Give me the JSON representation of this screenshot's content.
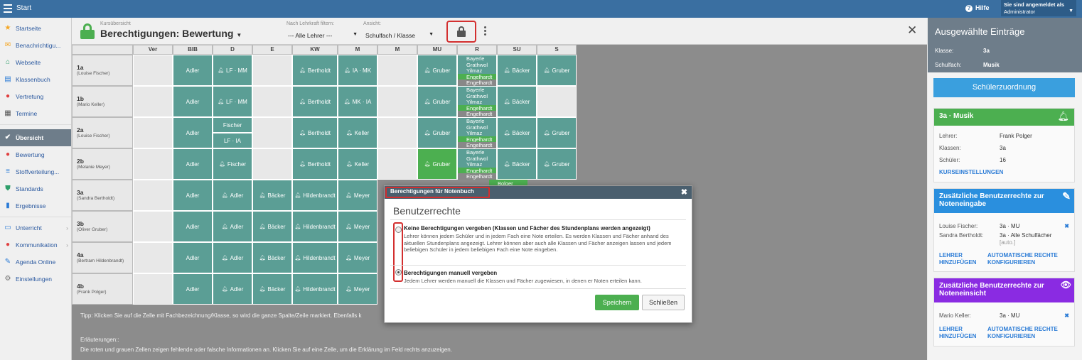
{
  "topbar": {
    "start": "Start",
    "help": "Hilfe",
    "logged_in": "Sie sind angemeldet als",
    "user": "Administrator"
  },
  "sidebar": {
    "items": [
      {
        "label": "Startseite",
        "icon": "star-icon",
        "color": "#f5a623"
      },
      {
        "label": "Benachrichtigu...",
        "icon": "envelope-icon",
        "color": "#f5a623"
      },
      {
        "label": "Webseite",
        "icon": "home-icon",
        "color": "#2e9e6a"
      },
      {
        "label": "Klassenbuch",
        "icon": "book-icon",
        "color": "#2a7bd6"
      },
      {
        "label": "Vertretung",
        "icon": "person-icon",
        "color": "#e04040"
      },
      {
        "label": "Termine",
        "icon": "calendar-icon",
        "color": "#555"
      },
      {
        "label": "Übersicht",
        "icon": "check-icon",
        "color": "#ffffff"
      },
      {
        "label": "Bewertung",
        "icon": "grade-icon",
        "color": "#e04040"
      },
      {
        "label": "Stoffverteilung...",
        "icon": "list-icon",
        "color": "#2a7bd6"
      },
      {
        "label": "Standards",
        "icon": "shield-icon",
        "color": "#2e9e6a"
      },
      {
        "label": "Ergebnisse",
        "icon": "chart-icon",
        "color": "#2a7bd6"
      },
      {
        "label": "Unterricht",
        "icon": "board-icon",
        "color": "#2a7bd6"
      },
      {
        "label": "Kommunikation",
        "icon": "chat-icon",
        "color": "#e04040"
      },
      {
        "label": "Agenda Online",
        "icon": "pen-icon",
        "color": "#2a7bd6"
      },
      {
        "label": "Einstellungen",
        "icon": "gear-icon",
        "color": "#777"
      }
    ]
  },
  "header": {
    "subtitle": "Kursübersicht",
    "title": "Berechtigungen: Bewertung",
    "filter_label": "Nach Lehrkraft filtern:",
    "filter_value": "--- Alle Lehrer ---",
    "view_label": "Ansicht:",
    "view_value": "Schulfach / Klasse"
  },
  "grid": {
    "columns": [
      "Ver",
      "BIB",
      "D",
      "E",
      "KW",
      "M",
      "M",
      "MU",
      "R",
      "SU",
      "S"
    ],
    "rows": [
      {
        "class": "1a",
        "teacher": "(Louise Fischer)",
        "cells": [
          "",
          "Adler",
          "LF · MM",
          "",
          "Bertholdt",
          "IA · MK",
          "",
          "Gruber",
          "R",
          "Bäcker",
          "Gruber"
        ]
      },
      {
        "class": "1b",
        "teacher": "(Mario Keller)",
        "cells": [
          "",
          "Adler",
          "LF · MM",
          "",
          "Bertholdt",
          "MK · IA",
          "",
          "Gruber",
          "R",
          "Bäcker",
          ""
        ]
      },
      {
        "class": "2a",
        "teacher": "(Louise Fischer)",
        "cells": [
          "",
          "Adler",
          "Fischer|LF · IA",
          "",
          "Bertholdt",
          "Keller",
          "",
          "Gruber",
          "R",
          "Bäcker",
          "Gruber"
        ]
      },
      {
        "class": "2b",
        "teacher": "(Melanie Meyer)",
        "cells": [
          "",
          "Adler",
          "Fischer",
          "",
          "Bertholdt",
          "Keller",
          "",
          "Gruber",
          "R",
          "Bäcker",
          "Gruber"
        ]
      },
      {
        "class": "3a",
        "teacher": "(Sandra Bertholdt)",
        "cells": [
          "",
          "Adler",
          "Adler",
          "Bäcker",
          "Hildenbrandt",
          "Meyer",
          "",
          "",
          "",
          "",
          ""
        ]
      },
      {
        "class": "3b",
        "teacher": "(Oliver Gruber)",
        "cells": [
          "",
          "Adler",
          "Adler",
          "Bäcker",
          "Hildenbrandt",
          "Meyer",
          "",
          "",
          "",
          "",
          ""
        ]
      },
      {
        "class": "4a",
        "teacher": "(Bertram Hildenbrandt)",
        "cells": [
          "",
          "Adler",
          "Adler",
          "Bäcker",
          "Hildenbrandt",
          "Meyer",
          "",
          "",
          "",
          "",
          ""
        ]
      },
      {
        "class": "4b",
        "teacher": "(Frank Polger)",
        "cells": [
          "",
          "Adler",
          "Adler",
          "Bäcker",
          "Hildenbrandt",
          "Meyer",
          "",
          "",
          "",
          "",
          ""
        ]
      }
    ],
    "r_names": [
      "Bayerle",
      "Grathwol",
      "Yilmaz",
      "Engelhardt",
      "Engelhardt"
    ],
    "r_partial": "Bolger"
  },
  "tip": "Tipp: Klicken Sie auf die Zelle mit Fachbezeichnung/Klasse, so wird die ganze Spalte/Zeile markiert. Ebenfalls k",
  "explain": {
    "title": "Erläuterungen::",
    "text": "Die roten und grauen Zellen zeigen fehlende oder falsche Informationen an. Klicken Sie auf eine Zelle, um die Erklärung im Feld rechts anzuzeigen."
  },
  "dialog": {
    "title": "Berechtigungen für Notenbuch",
    "heading": "Benutzerrechte",
    "opt1_title": "Keine Berechtigungen vergeben (Klassen und Fächer des Stundenplans werden angezeigt)",
    "opt1_text": "Lehrer können jedem Schüler und in jedem Fach eine Note erteilen. Es werden Klassen und Fächer anhand des aktuellen Stundenplans angezeigt. Lehrer können aber auch alle Klassen und Fächer anzeigen lassen und jedem beliebigen Schüler in jedem beliebigen Fach eine Note eingeben.",
    "opt2_title": "Berechtigungen manuell vergeben",
    "opt2_text": "Jedem Lehrer werden manuell die Klassen und Fächer zugewiesen, in denen er Noten erteilen kann.",
    "save": "Speichern",
    "close": "Schließen"
  },
  "right": {
    "title": "Ausgewählte Einträge",
    "klasse_label": "Klasse:",
    "klasse": "3a",
    "fach_label": "Schulfach:",
    "fach": "Musik",
    "assign_btn": "Schülerzuordnung",
    "card1": {
      "title": "3a · Musik",
      "color": "#4caf50",
      "lehrer_label": "Lehrer:",
      "lehrer": "Frank Polger",
      "klassen_label": "Klassen:",
      "klassen": "3a",
      "schueler_label": "Schüler:",
      "schueler": "16",
      "link": "KURSEINSTELLUNGEN"
    },
    "card2": {
      "title": "Zusätzliche Benutzerrechte zur Noteneingabe",
      "color": "#2a8fde",
      "r1_name": "Louise Fischer:",
      "r1_val": "3a · MU",
      "r2_name": "Sandra Bertholdt:",
      "r2_val": "3a · Alle Schulfächer",
      "r2_note": "[auto.]",
      "link1": "LEHRER HINZUFÜGEN",
      "link2": "AUTOMATISCHE RECHTE KONFIGURIEREN"
    },
    "card3": {
      "title": "Zusätzliche Benutzerrechte zur Noteneinsicht",
      "color": "#8a2be2",
      "r1_name": "Mario Keller:",
      "r1_val": "3a · MU",
      "link1": "LEHRER HINZUFÜGEN",
      "link2": "AUTOMATISCHE RECHTE KONFIGURIEREN"
    }
  }
}
